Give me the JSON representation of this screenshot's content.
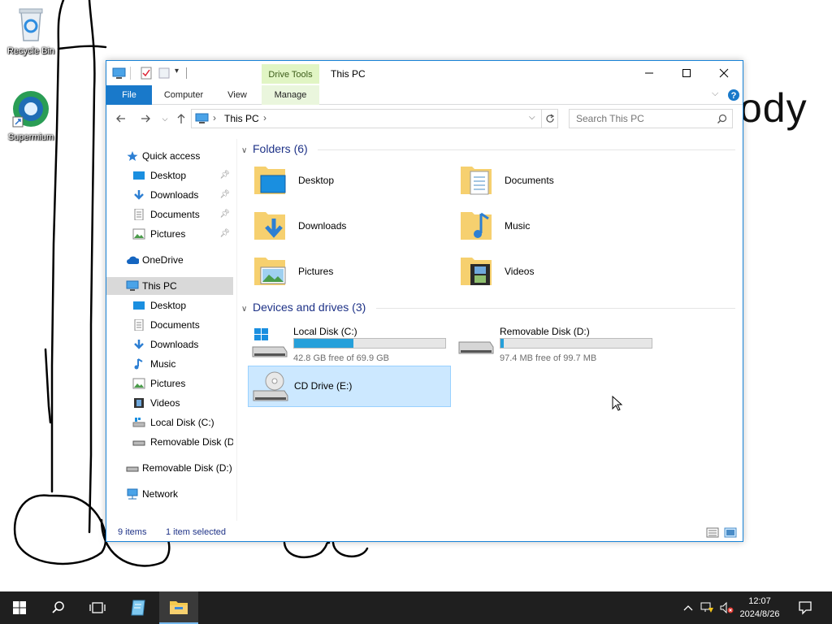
{
  "desktop": {
    "icons": [
      {
        "label": "Recycle Bin",
        "icon": "recycle-bin-icon"
      },
      {
        "label": "Supermium",
        "icon": "supermium-icon"
      }
    ],
    "background_text": "ody"
  },
  "window": {
    "title": "This PC",
    "contextual_tab": "Drive Tools",
    "ribbon_tabs": [
      "File",
      "Computer",
      "View",
      "Manage"
    ],
    "address": {
      "crumb": "This PC"
    },
    "search": {
      "placeholder": "Search This PC"
    },
    "nav": {
      "quick_access": "Quick access",
      "quick_items": [
        "Desktop",
        "Downloads",
        "Documents",
        "Pictures"
      ],
      "onedrive": "OneDrive",
      "this_pc": "This PC",
      "pc_items": [
        "Desktop",
        "Documents",
        "Downloads",
        "Music",
        "Pictures",
        "Videos",
        "Local Disk (C:)",
        "Removable Disk (D:"
      ],
      "removable": "Removable Disk (D:)",
      "network": "Network"
    },
    "folders_header": "Folders (6)",
    "folders": [
      "Desktop",
      "Documents",
      "Downloads",
      "Music",
      "Pictures",
      "Videos"
    ],
    "devices_header": "Devices and drives (3)",
    "drives": [
      {
        "name": "Local Disk (C:)",
        "free": "42.8 GB free of 69.9 GB",
        "used_fraction": 0.39
      },
      {
        "name": "Removable Disk (D:)",
        "free": "97.4 MB free of 99.7 MB",
        "used_fraction": 0.02
      },
      {
        "name": "CD Drive (E:)"
      }
    ],
    "status": {
      "items": "9 items",
      "selected": "1 item selected"
    }
  },
  "taskbar": {
    "time": "12:07",
    "date": "2024/8/26"
  },
  "colors": {
    "accent": "#1979ca",
    "drive_bar": "#26a0da",
    "selection": "#cce8ff",
    "taskbar": "#1f1f1f"
  }
}
